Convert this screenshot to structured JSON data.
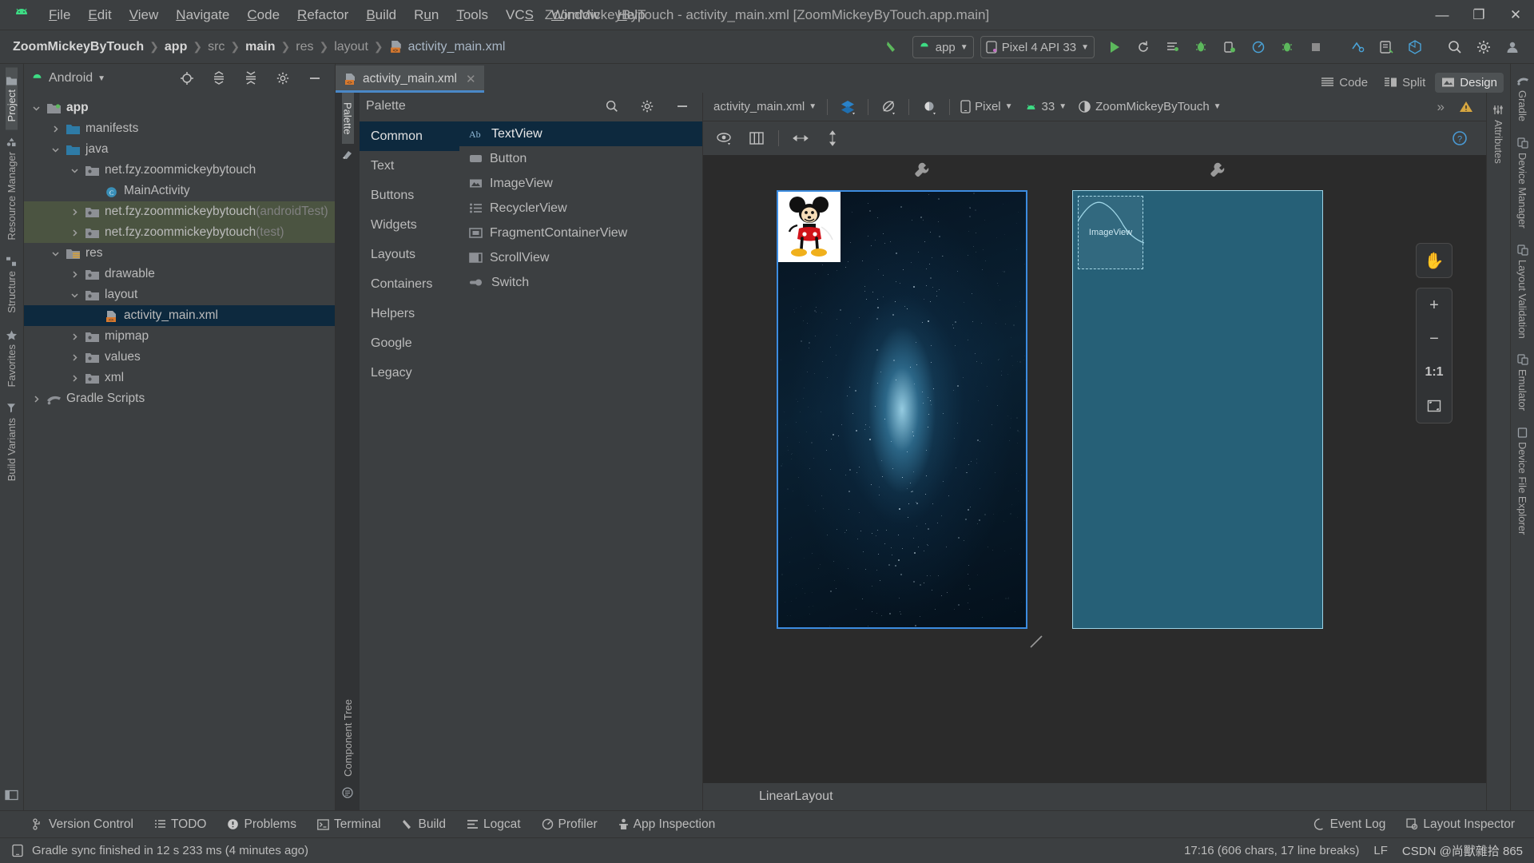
{
  "window": {
    "title": "ZoomMickeyByTouch - activity_main.xml [ZoomMickeyByTouch.app.main]",
    "minimize": "—",
    "maximize": "❐",
    "close": "✕"
  },
  "menu": [
    {
      "label": "File",
      "mnemonic": "F"
    },
    {
      "label": "Edit",
      "mnemonic": "E"
    },
    {
      "label": "View",
      "mnemonic": "V"
    },
    {
      "label": "Navigate",
      "mnemonic": "N"
    },
    {
      "label": "Code",
      "mnemonic": "C"
    },
    {
      "label": "Refactor",
      "mnemonic": "R"
    },
    {
      "label": "Build",
      "mnemonic": "B"
    },
    {
      "label": "Run",
      "mnemonic": "u"
    },
    {
      "label": "Tools",
      "mnemonic": "T"
    },
    {
      "label": "VCS",
      "mnemonic": "S"
    },
    {
      "label": "Window",
      "mnemonic": "W"
    },
    {
      "label": "Help",
      "mnemonic": "H"
    }
  ],
  "breadcrumbs": [
    {
      "label": "ZoomMickeyByTouch",
      "style": "bold"
    },
    {
      "label": "app",
      "style": "bold"
    },
    {
      "label": "src",
      "style": "dim"
    },
    {
      "label": "main",
      "style": "bold"
    },
    {
      "label": "res",
      "style": "dim"
    },
    {
      "label": "layout",
      "style": "dim"
    },
    {
      "label": "activity_main.xml",
      "style": "normal"
    }
  ],
  "toolbar": {
    "build_icon": "hammer-icon",
    "run_config": "app",
    "device_target": "Pixel 4 API 33",
    "run": "run-icon",
    "rerun": "rerun-icon",
    "apply_changes": "apply-changes-icon",
    "debug": "debug-icon",
    "attach_debugger": "attach-debugger-icon",
    "profile": "profile-icon",
    "run_tests": "run-tests-icon",
    "stop": "stop-icon",
    "device_manager": "device-manager-icon",
    "sdk_manager": "sdk-manager-icon",
    "avd": "avd-icon",
    "search": "search-icon",
    "settings": "gear-icon",
    "account": "account-icon"
  },
  "left_rail": [
    {
      "label": "Project",
      "icon": "project-icon",
      "selected": true
    },
    {
      "label": "Resource Manager",
      "icon": "resource-manager-icon",
      "selected": false
    },
    {
      "label": "Structure",
      "icon": "structure-icon",
      "selected": false
    },
    {
      "label": "Favorites",
      "icon": "star-icon",
      "selected": false
    },
    {
      "label": "Build Variants",
      "icon": "build-variants-icon",
      "selected": false
    }
  ],
  "right_rail": [
    {
      "label": "Gradle",
      "icon": "gradle-icon"
    },
    {
      "label": "Device Manager",
      "icon": "device-manager-icon"
    },
    {
      "label": "Layout Validation",
      "icon": "layout-validation-icon"
    },
    {
      "label": "Emulator",
      "icon": "emulator-icon"
    },
    {
      "label": "Device File Explorer",
      "icon": "device-file-explorer-icon"
    }
  ],
  "attributes_rail": {
    "label": "Attributes",
    "icon": "sliders-icon"
  },
  "project": {
    "view_selector": "Android",
    "actions": [
      "target-icon",
      "expand-all-icon",
      "collapse-all-icon",
      "gear-icon",
      "minimize-icon"
    ],
    "tree": [
      {
        "label": "app",
        "depth": 0,
        "arrow": "down",
        "icon": "module-folder",
        "bold": true,
        "suffix": "",
        "state": "normal"
      },
      {
        "label": "manifests",
        "depth": 1,
        "arrow": "right",
        "icon": "folder-blue",
        "bold": false,
        "suffix": "",
        "state": "normal"
      },
      {
        "label": "java",
        "depth": 1,
        "arrow": "down",
        "icon": "folder-blue",
        "bold": false,
        "suffix": "",
        "state": "normal"
      },
      {
        "label": "net.fzy.zoommickeybytouch",
        "depth": 2,
        "arrow": "down",
        "icon": "package-folder",
        "bold": false,
        "suffix": "",
        "state": "normal"
      },
      {
        "label": "MainActivity",
        "depth": 3,
        "arrow": "none",
        "icon": "class-icon",
        "bold": false,
        "suffix": "",
        "state": "normal"
      },
      {
        "label": "net.fzy.zoommickeybytouch",
        "depth": 2,
        "arrow": "right",
        "icon": "package-folder",
        "bold": false,
        "suffix": "(androidTest)",
        "state": "test"
      },
      {
        "label": "net.fzy.zoommickeybytouch",
        "depth": 2,
        "arrow": "right",
        "icon": "package-folder",
        "bold": false,
        "suffix": "(test)",
        "state": "test"
      },
      {
        "label": "res",
        "depth": 1,
        "arrow": "down",
        "icon": "res-folder",
        "bold": false,
        "suffix": "",
        "state": "normal"
      },
      {
        "label": "drawable",
        "depth": 2,
        "arrow": "right",
        "icon": "package-folder",
        "bold": false,
        "suffix": "",
        "state": "normal"
      },
      {
        "label": "layout",
        "depth": 2,
        "arrow": "down",
        "icon": "package-folder",
        "bold": false,
        "suffix": "",
        "state": "normal"
      },
      {
        "label": "activity_main.xml",
        "depth": 3,
        "arrow": "none",
        "icon": "xml-layout-icon",
        "bold": false,
        "suffix": "",
        "state": "selected"
      },
      {
        "label": "mipmap",
        "depth": 2,
        "arrow": "right",
        "icon": "package-folder",
        "bold": false,
        "suffix": "",
        "state": "normal"
      },
      {
        "label": "values",
        "depth": 2,
        "arrow": "right",
        "icon": "package-folder",
        "bold": false,
        "suffix": "",
        "state": "normal"
      },
      {
        "label": "xml",
        "depth": 2,
        "arrow": "right",
        "icon": "package-folder",
        "bold": false,
        "suffix": "",
        "state": "normal"
      },
      {
        "label": "Gradle Scripts",
        "depth": 0,
        "arrow": "right",
        "icon": "gradle-icon",
        "bold": false,
        "suffix": "",
        "state": "normal"
      }
    ]
  },
  "editor": {
    "tab": {
      "label": "activity_main.xml",
      "icon": "xml-layout-icon",
      "close": "✕"
    },
    "view_modes": [
      {
        "label": "Code",
        "icon": "code-icon",
        "selected": false
      },
      {
        "label": "Split",
        "icon": "split-icon",
        "selected": false
      },
      {
        "label": "Design",
        "icon": "design-icon",
        "selected": true
      }
    ]
  },
  "palette": {
    "title": "Palette",
    "rail_label": "Palette",
    "actions": [
      "search-icon",
      "gear-icon",
      "minimize-icon"
    ],
    "categories": [
      {
        "label": "Common",
        "selected": true
      },
      {
        "label": "Text",
        "selected": false
      },
      {
        "label": "Buttons",
        "selected": false
      },
      {
        "label": "Widgets",
        "selected": false
      },
      {
        "label": "Layouts",
        "selected": false
      },
      {
        "label": "Containers",
        "selected": false
      },
      {
        "label": "Helpers",
        "selected": false
      },
      {
        "label": "Google",
        "selected": false
      },
      {
        "label": "Legacy",
        "selected": false
      }
    ],
    "items": [
      {
        "label": "TextView",
        "icon": "textview-icon",
        "selected": true
      },
      {
        "label": "Button",
        "icon": "button-icon",
        "selected": false
      },
      {
        "label": "ImageView",
        "icon": "imageview-icon",
        "selected": false
      },
      {
        "label": "RecyclerView",
        "icon": "recyclerview-icon",
        "selected": false
      },
      {
        "label": "FragmentContainerView",
        "icon": "fragment-icon",
        "selected": false
      },
      {
        "label": "ScrollView",
        "icon": "scrollview-icon",
        "selected": false
      },
      {
        "label": "Switch",
        "icon": "switch-icon",
        "selected": false
      }
    ]
  },
  "component_tree": {
    "rail_label": "Component Tree",
    "icon": "component-tree-icon"
  },
  "design": {
    "file_selector": "activity_main.xml",
    "toolbar_icons": [
      "design-surface-mode-icon",
      "orientation-icon",
      "theme-icon"
    ],
    "device": "Pixel",
    "api_level": "33",
    "theme": "ZoomMickeyByTouch",
    "overflow": "»",
    "warning_icon": "warning-icon",
    "sub_toolbar": [
      "eye-icon",
      "blueprint-icon",
      "horizontal-constraint-icon",
      "vertical-constraint-icon"
    ],
    "help_icon": "help-icon",
    "root_component": "LinearLayout",
    "zoom_controls": [
      {
        "label": "✋",
        "name": "pan-tool-button"
      },
      {
        "label": "+",
        "name": "zoom-in-button"
      },
      {
        "label": "−",
        "name": "zoom-out-button"
      },
      {
        "label": "1:1",
        "name": "zoom-actual-size-button"
      },
      {
        "label": "⛶",
        "name": "zoom-to-fit-button"
      }
    ],
    "previews": [
      {
        "name": "rendered-preview",
        "label": ""
      },
      {
        "name": "blueprint-preview",
        "label": "ImageView"
      }
    ]
  },
  "bottom_bar": {
    "left": [
      {
        "label": "Version Control",
        "icon": "version-control-icon"
      },
      {
        "label": "TODO",
        "icon": "todo-icon"
      },
      {
        "label": "Problems",
        "icon": "problems-icon"
      },
      {
        "label": "Terminal",
        "icon": "terminal-icon"
      },
      {
        "label": "Build",
        "icon": "build-icon"
      },
      {
        "label": "Logcat",
        "icon": "logcat-icon"
      },
      {
        "label": "Profiler",
        "icon": "profiler-icon"
      },
      {
        "label": "App Inspection",
        "icon": "app-inspection-icon"
      }
    ],
    "right": [
      {
        "label": "Event Log",
        "icon": "event-log-icon"
      },
      {
        "label": "Layout Inspector",
        "icon": "layout-inspector-icon"
      }
    ]
  },
  "status_bar": {
    "message": "Gradle sync finished in 12 s 233 ms (4 minutes ago)",
    "icon": "status-message-icon",
    "caret": "17:16 (606 chars, 17 line breaks)",
    "line_separator": "LF",
    "watermark": "CSDN @尚獸雜拾 865"
  },
  "colors": {
    "accent_blue": "#4a88c7",
    "selection_blue": "#0d293e",
    "test_green": "#4b5441",
    "panel_bg": "#3c3f41",
    "canvas_bg": "#2b2b2b",
    "blueprint": "#266077",
    "android_green": "#3ddc84"
  }
}
